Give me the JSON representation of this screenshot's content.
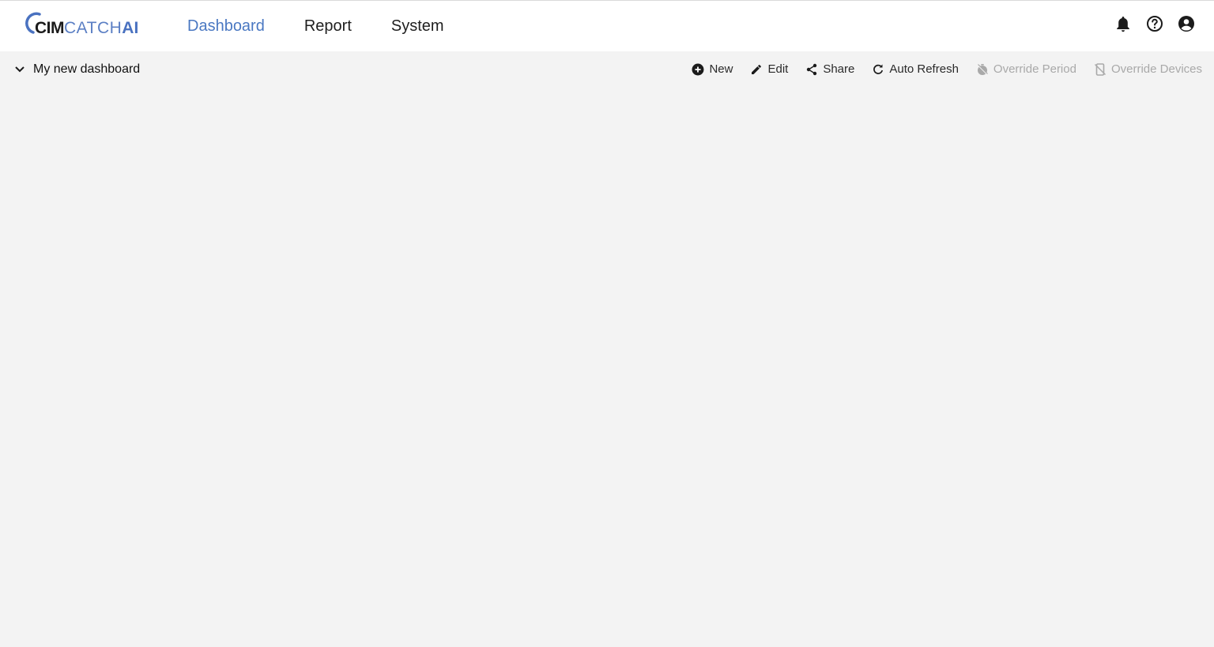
{
  "brand": {
    "part1": "CIM",
    "part2": "CATCH",
    "part3": "AI",
    "colors": {
      "dark": "#1b1b1b",
      "blue": "#4a72c0"
    }
  },
  "nav": {
    "items": [
      {
        "label": "Dashboard",
        "active": true
      },
      {
        "label": "Report",
        "active": false
      },
      {
        "label": "System",
        "active": false
      }
    ],
    "active_color": "#4a78c2"
  },
  "header_icons": [
    "bell-icon",
    "help-circle-icon",
    "account-circle-icon"
  ],
  "dashboard": {
    "selected": "My new dashboard"
  },
  "actions": {
    "new": "New",
    "edit": "Edit",
    "share": "Share",
    "auto_refresh": "Auto Refresh",
    "override_period": "Override Period",
    "override_devices": "Override Devices"
  }
}
